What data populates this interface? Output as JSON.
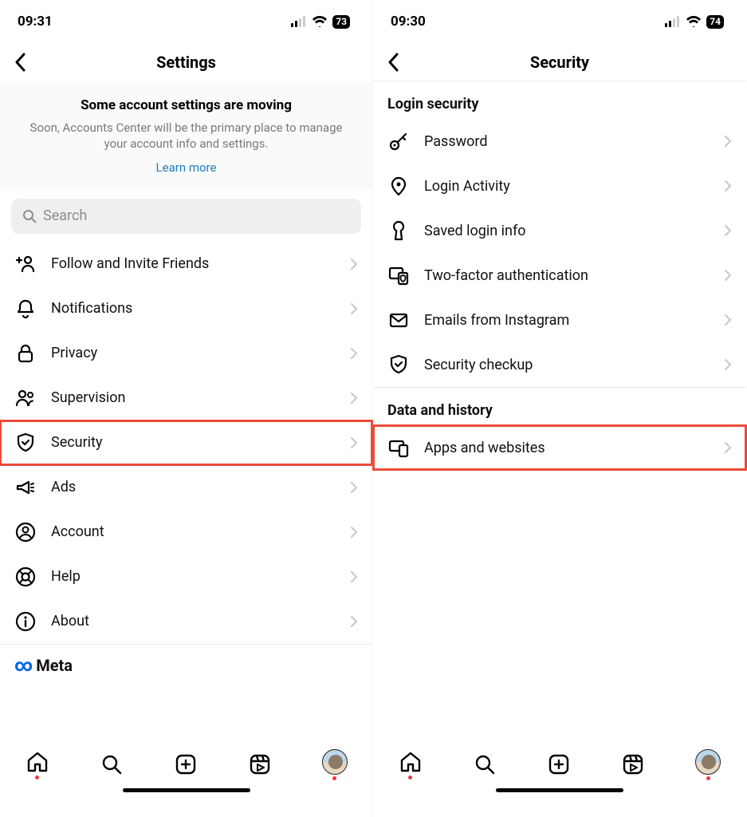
{
  "left": {
    "status": {
      "time": "09:31",
      "battery": "73"
    },
    "header": {
      "title": "Settings"
    },
    "notice": {
      "title": "Some account settings are moving",
      "body": "Soon, Accounts Center will be the primary place to manage your account info and settings.",
      "link": "Learn more"
    },
    "search": {
      "placeholder": "Search"
    },
    "rows": [
      {
        "label": "Follow and Invite Friends"
      },
      {
        "label": "Notifications"
      },
      {
        "label": "Privacy"
      },
      {
        "label": "Supervision"
      },
      {
        "label": "Security"
      },
      {
        "label": "Ads"
      },
      {
        "label": "Account"
      },
      {
        "label": "Help"
      },
      {
        "label": "About"
      }
    ],
    "brand": "Meta"
  },
  "right": {
    "status": {
      "time": "09:30",
      "battery": "74"
    },
    "header": {
      "title": "Security"
    },
    "section1": {
      "title": "Login security"
    },
    "rows1": [
      {
        "label": "Password"
      },
      {
        "label": "Login Activity"
      },
      {
        "label": "Saved login info"
      },
      {
        "label": "Two-factor authentication"
      },
      {
        "label": "Emails from Instagram"
      },
      {
        "label": "Security checkup"
      }
    ],
    "section2": {
      "title": "Data and history"
    },
    "rows2": [
      {
        "label": "Apps and websites"
      }
    ]
  }
}
